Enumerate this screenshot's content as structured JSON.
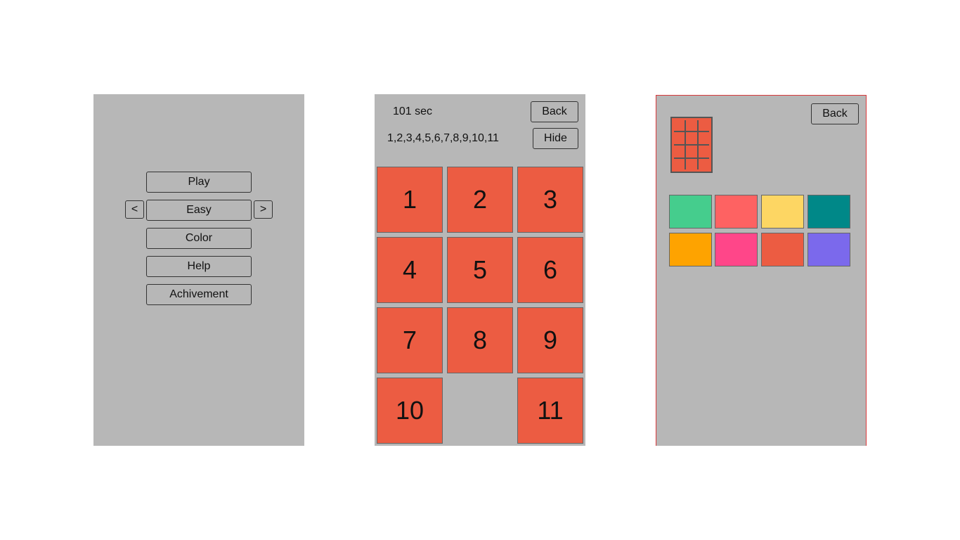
{
  "menu": {
    "play_label": "Play",
    "prev_label": "<",
    "difficulty": "Easy",
    "next_label": ">",
    "color_label": "Color",
    "help_label": "Help",
    "achievement_label": "Achivement"
  },
  "game": {
    "timer": "101 sec",
    "sequence": "1,2,3,4,5,6,7,8,9,10,11",
    "back_label": "Back",
    "hide_label": "Hide",
    "tile_color": "#ec5c42",
    "tiles": [
      "1",
      "2",
      "3",
      "4",
      "5",
      "6",
      "7",
      "8",
      "9",
      "10",
      "",
      "11"
    ]
  },
  "color_picker": {
    "back_label": "Back",
    "preview_color": "#ec5c42",
    "swatches": [
      "#45cd8d",
      "#fe6262",
      "#fdd663",
      "#008888",
      "#fea300",
      "#ff4689",
      "#ec5c42",
      "#7b69ec"
    ]
  },
  "colors": {
    "panel_bg": "#b7b7b7",
    "page_bg": "#ffffff"
  }
}
